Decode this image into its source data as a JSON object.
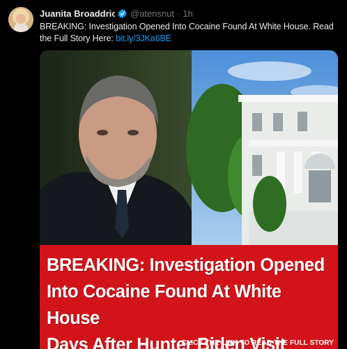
{
  "tweet": {
    "author_name": "Juanita Broaddrick",
    "handle": "@atensnut",
    "separator": "·",
    "time": "1h",
    "text": "BREAKING: Investigation Opened Into Cocaine Found At White House. Read the Full Story Here:",
    "link_text": "bit.ly/3JKa6BE"
  },
  "media": {
    "headline_lines": [
      "BREAKING: Investigation Opened",
      "Into Cocaine Found At White House",
      "Days After Hunter Biden Visit"
    ],
    "cta": "CLICK THE LINK TO READ THE FULL STORY"
  },
  "colors": {
    "background": "#000000",
    "link": "#1d9bf0",
    "verified": "#1d9bf0",
    "banner": "#d3131a",
    "muted": "#71767b"
  },
  "icons": [
    "verified-badge-icon"
  ]
}
